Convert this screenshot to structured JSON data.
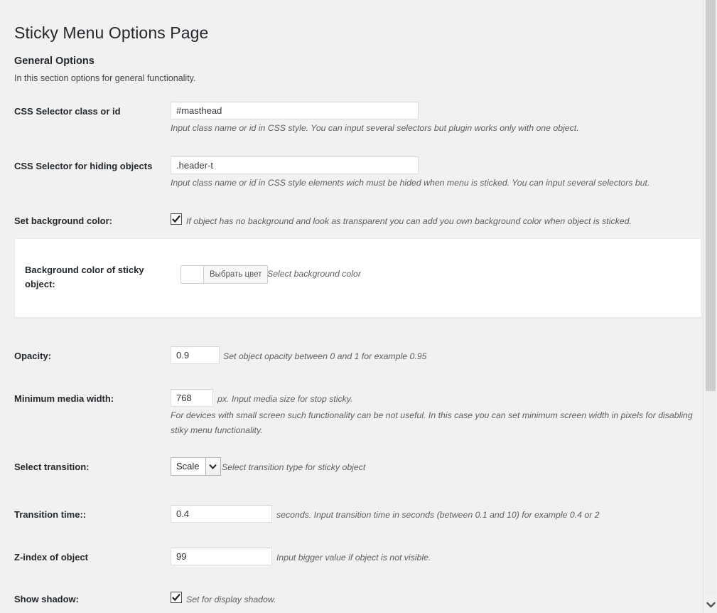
{
  "page": {
    "title": "Sticky Menu Options Page",
    "section_title": "General Options",
    "section_desc": "In this section options for general functionality."
  },
  "fields": {
    "css_selector": {
      "label": "CSS Selector class or id",
      "value": "#masthead",
      "desc": "Input class name or id in CSS style. You can input several selectors but plugin works only with one object."
    },
    "hiding_selector": {
      "label": "CSS Selector for hiding objects",
      "value": ".header-t",
      "desc": "Input class name or id in CSS style elements wich must be hided when menu is sticked. You can input several selectors but."
    },
    "set_background": {
      "label": "Set background color:",
      "checked": true,
      "desc": "If object has no background and look as transparent you can add you own background color when object is sticked."
    },
    "background_color": {
      "label": "Background color of sticky object:",
      "button_label": "Выбрать цвет",
      "swatch_color": "#ffffff",
      "desc": "Select background color"
    },
    "opacity": {
      "label": "Opacity:",
      "value": "0.9",
      "desc": "Set object opacity between 0 and 1 for example 0.95"
    },
    "min_media_width": {
      "label": "Minimum media width:",
      "value": "768",
      "desc": "px. Input media size for stop sticky.",
      "desc_long": "For devices with small screen such functionality can be not useful. In this case you can set minimum screen width in pixels for disabling stiky menu functionality."
    },
    "transition": {
      "label": "Select transition:",
      "value": "Scale",
      "desc": "Select transition type for sticky object"
    },
    "transition_time": {
      "label": "Transition time::",
      "value": "0.4",
      "desc": "seconds. Input transition time in seconds (between 0.1 and 10) for example 0.4 or 2"
    },
    "z_index": {
      "label": "Z-index of object",
      "value": "99",
      "desc": "Input bigger value if object is not visible."
    },
    "show_shadow": {
      "label": "Show shadow:",
      "checked": true,
      "desc": "Set for display shadow."
    }
  },
  "colors": {
    "page_background": "#f1f1f1",
    "panel_background": "#ffffff",
    "text": "#23282d",
    "description_text": "#5e5e5e",
    "scrollbar_thumb": "#cdcdcd"
  }
}
